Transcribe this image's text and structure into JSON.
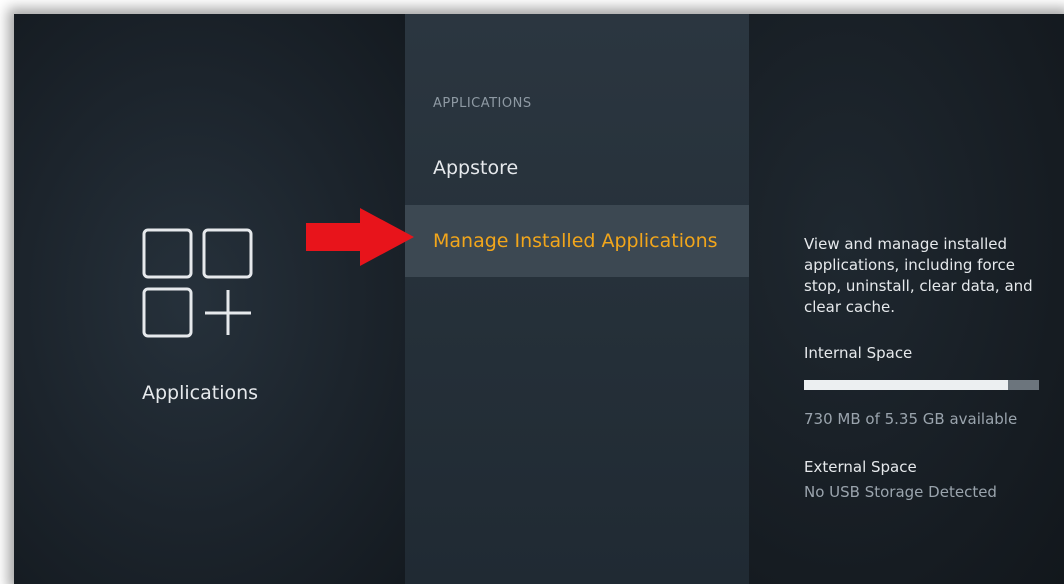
{
  "left": {
    "title": "Applications",
    "icon": "apps-grid-icon"
  },
  "menu": {
    "header": "APPLICATIONS",
    "items": [
      {
        "label": "Appstore",
        "selected": false
      },
      {
        "label": "Manage Installed Applications",
        "selected": true
      }
    ]
  },
  "details": {
    "description": "View and manage installed applications, including force stop, uninstall, clear data, and clear cache.",
    "internal": {
      "label": "Internal Space",
      "value": "730 MB of 5.35 GB available",
      "used_fraction": 0.87
    },
    "external": {
      "label": "External Space",
      "value": "No USB Storage Detected"
    }
  },
  "colors": {
    "background": "#1b2128",
    "selected_bg": "#3c4852",
    "selected_text": "#f2a61b",
    "arrow": "#e8141b",
    "text": "#e6e9ec",
    "muted_text": "#8e99a3"
  }
}
